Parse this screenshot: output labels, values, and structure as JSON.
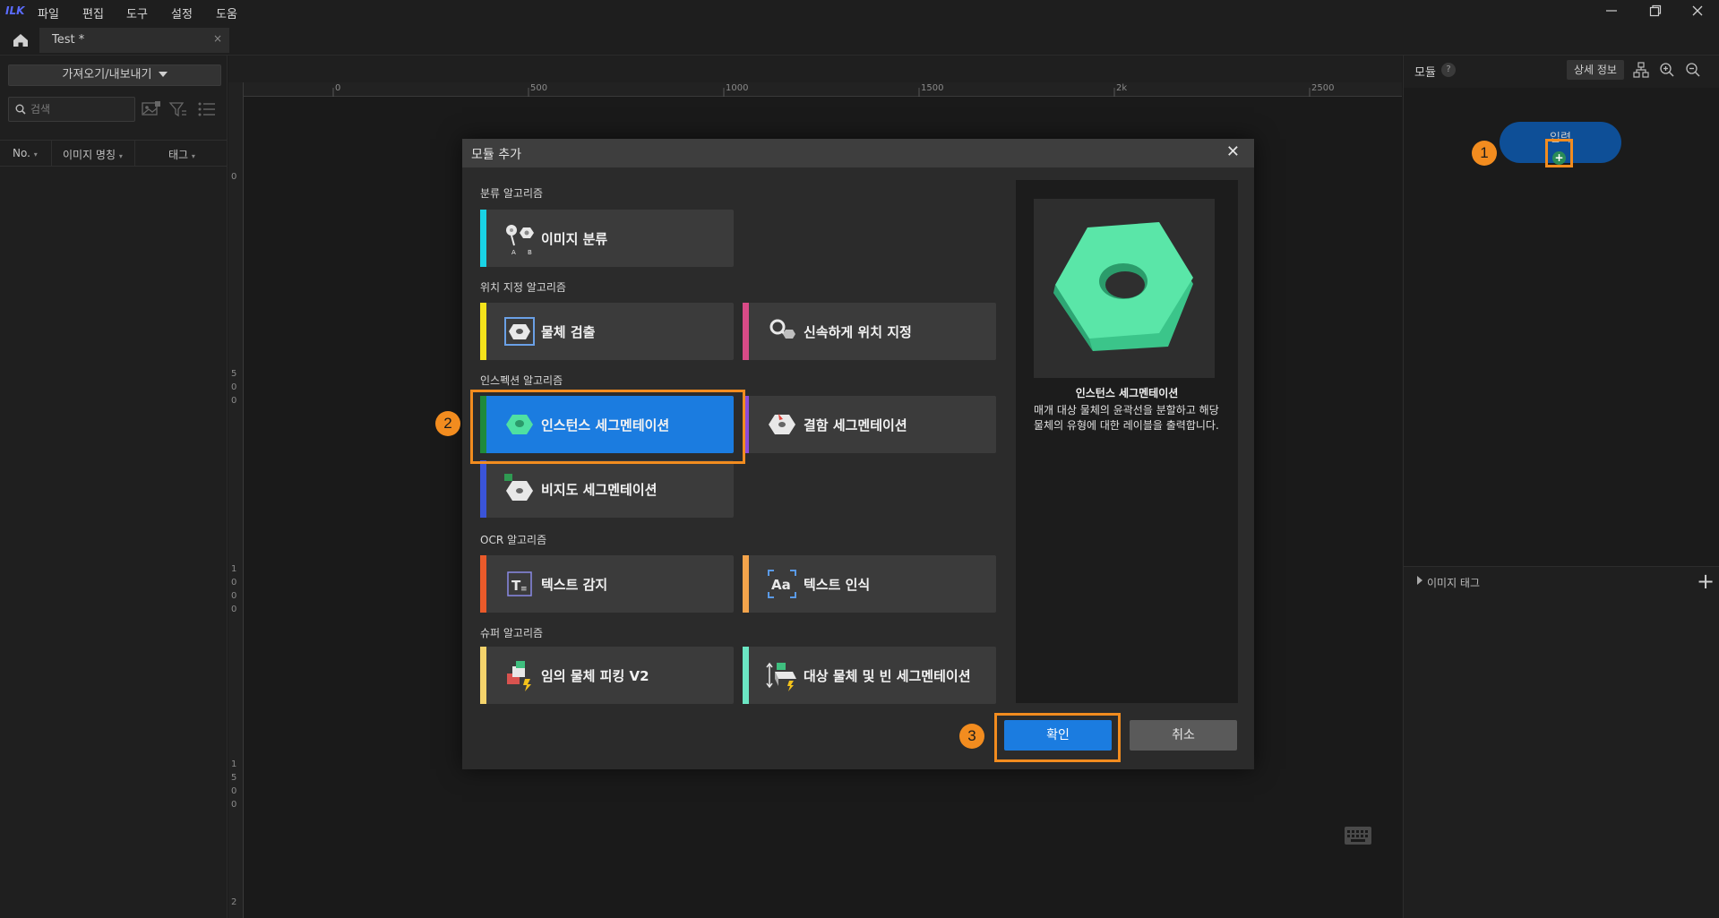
{
  "app": {
    "logo": "ILK"
  },
  "menu": [
    "파일",
    "편집",
    "도구",
    "설정",
    "도움"
  ],
  "tab": {
    "label": "Test *",
    "close": "×"
  },
  "left_panel": {
    "import_export_label": "가져오기/내보내기",
    "search_placeholder": "검색",
    "columns": [
      "No.",
      "이미지 명칭",
      "태그"
    ]
  },
  "canvas": {
    "ruler_top_labels": [
      "0",
      "500",
      "1000",
      "1500",
      "2k",
      "2500"
    ],
    "ruler_left_labels": [
      "0",
      "5 0 0",
      "1 0 0 0",
      "1 5 0 0",
      "2"
    ]
  },
  "right_panel": {
    "title": "모듈",
    "help": "?",
    "details_label": "상세 정보",
    "input_node_label": "입력",
    "add_node": "+",
    "image_tag_label": "이미지 태그",
    "image_tag_add": "+"
  },
  "callouts": [
    "1",
    "2",
    "3"
  ],
  "modal": {
    "title": "모듈 추가",
    "close": "✕",
    "sections": [
      {
        "label": "분류 알고리즘"
      },
      {
        "label": "위치 지정 알고리즘"
      },
      {
        "label": "인스펙션 알고리즘"
      },
      {
        "label": "OCR 알고리즘"
      },
      {
        "label": "슈퍼 알고리즘"
      }
    ],
    "cards": [
      {
        "label": "이미지 분류",
        "color": "#19d3e6",
        "icon": "classification-icon"
      },
      {
        "label": "물체 검출",
        "color": "#f4e31b",
        "icon": "object-detection-icon"
      },
      {
        "label": "신속하게 위치 지정",
        "color": "#d94b87",
        "icon": "fast-positioning-icon"
      },
      {
        "label": "인스턴스 세그멘테이션",
        "color": "#1f8a3a",
        "icon": "instance-segmentation-icon",
        "selected": true
      },
      {
        "label": "결함 세그멘테이션",
        "color": "#8c4bd9",
        "icon": "defect-segmentation-icon"
      },
      {
        "label": "비지도 세그멘테이션",
        "color": "#3a54d9",
        "icon": "unsupervised-segmentation-icon"
      },
      {
        "label": "텍스트 감지",
        "color": "#ea5a2a",
        "icon": "text-detection-icon"
      },
      {
        "label": "텍스트 인식",
        "color": "#f4a44b",
        "icon": "text-recognition-icon"
      },
      {
        "label": "임의 물체 피킹 V2",
        "color": "#f4d36b",
        "icon": "random-picking-icon"
      },
      {
        "label": "대상 물체 및 빈 세그멘테이션",
        "color": "#6be6c3",
        "icon": "bin-segmentation-icon"
      }
    ],
    "preview": {
      "title": "인스턴스 세그멘테이션",
      "description": "매개 대상 물체의 윤곽선을 분할하고 해당 물체의 유형에 대한 레이블을 출력합니다."
    },
    "confirm_label": "확인",
    "cancel_label": "취소"
  },
  "colors": {
    "accent": "#1b7ce0",
    "callout": "#f28c1f"
  }
}
